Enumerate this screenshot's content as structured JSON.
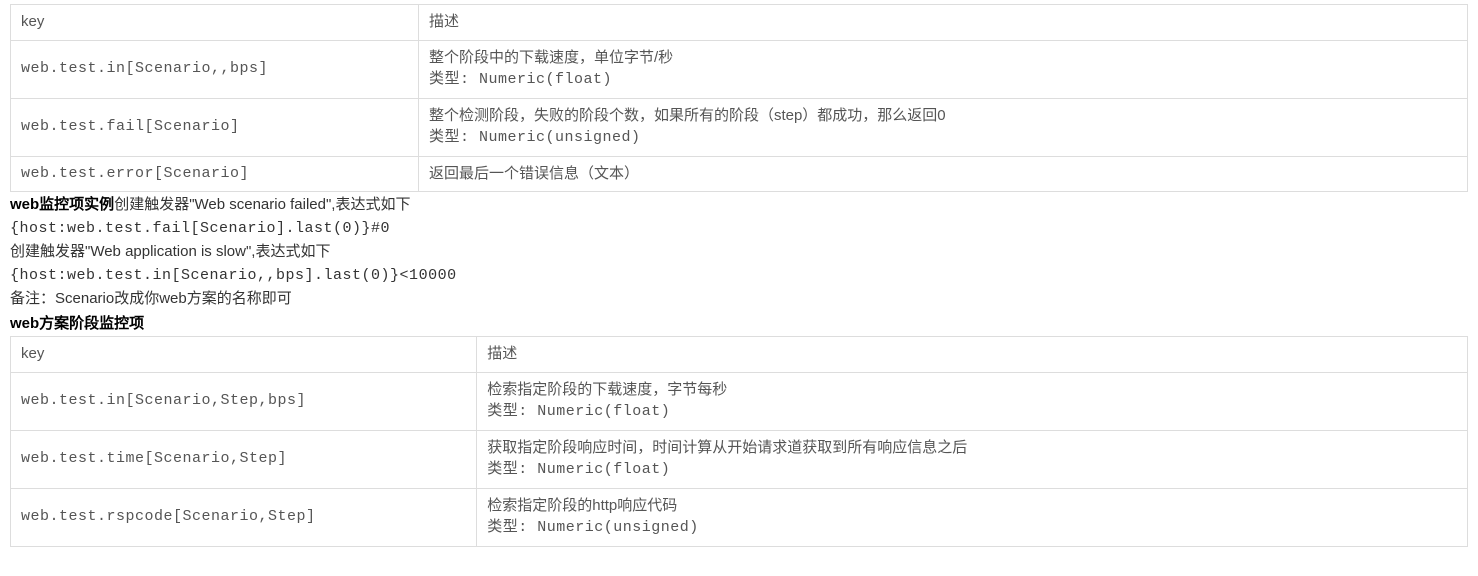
{
  "table1": {
    "headers": {
      "col1": "key",
      "col2": "描述"
    },
    "rows": [
      {
        "key": "web.test.in[Scenario,,bps]",
        "desc1": "整个阶段中的下载速度，单位字节/秒",
        "desc2": "类型: Numeric(float)"
      },
      {
        "key": "web.test.fail[Scenario]",
        "desc1": "整个检测阶段，失败的阶段个数，如果所有的阶段（step）都成功，那么返回0",
        "desc2": "类型: Numeric(unsigned)"
      },
      {
        "key": "web.test.error[Scenario]",
        "desc1": "返回最后一个错误信息（文本）",
        "desc2": ""
      }
    ]
  },
  "middle": {
    "line1_bold": "web监控项实例",
    "line1_rest": "创建触发器\"Web scenario failed\",表达式如下",
    "line2": "{host:web.test.fail[Scenario].last(0)}#0",
    "line3": "创建触发器\"Web application is slow\",表达式如下",
    "line4": "{host:web.test.in[Scenario,,bps].last(0)}<10000",
    "line5": "备注：Scenario改成你web方案的名称即可",
    "heading": "web方案阶段监控项"
  },
  "table2": {
    "headers": {
      "col1": "key",
      "col2": "描述"
    },
    "rows": [
      {
        "key": "web.test.in[Scenario,Step,bps]",
        "desc1": "检索指定阶段的下载速度，字节每秒",
        "desc2": "类型: Numeric(float)"
      },
      {
        "key": "web.test.time[Scenario,Step]",
        "desc1": "获取指定阶段响应时间，时间计算从开始请求道获取到所有响应信息之后",
        "desc2": "类型: Numeric(float)"
      },
      {
        "key": "web.test.rspcode[Scenario,Step]",
        "desc1": "检索指定阶段的http响应代码",
        "desc2": "类型: Numeric(unsigned)"
      }
    ]
  }
}
